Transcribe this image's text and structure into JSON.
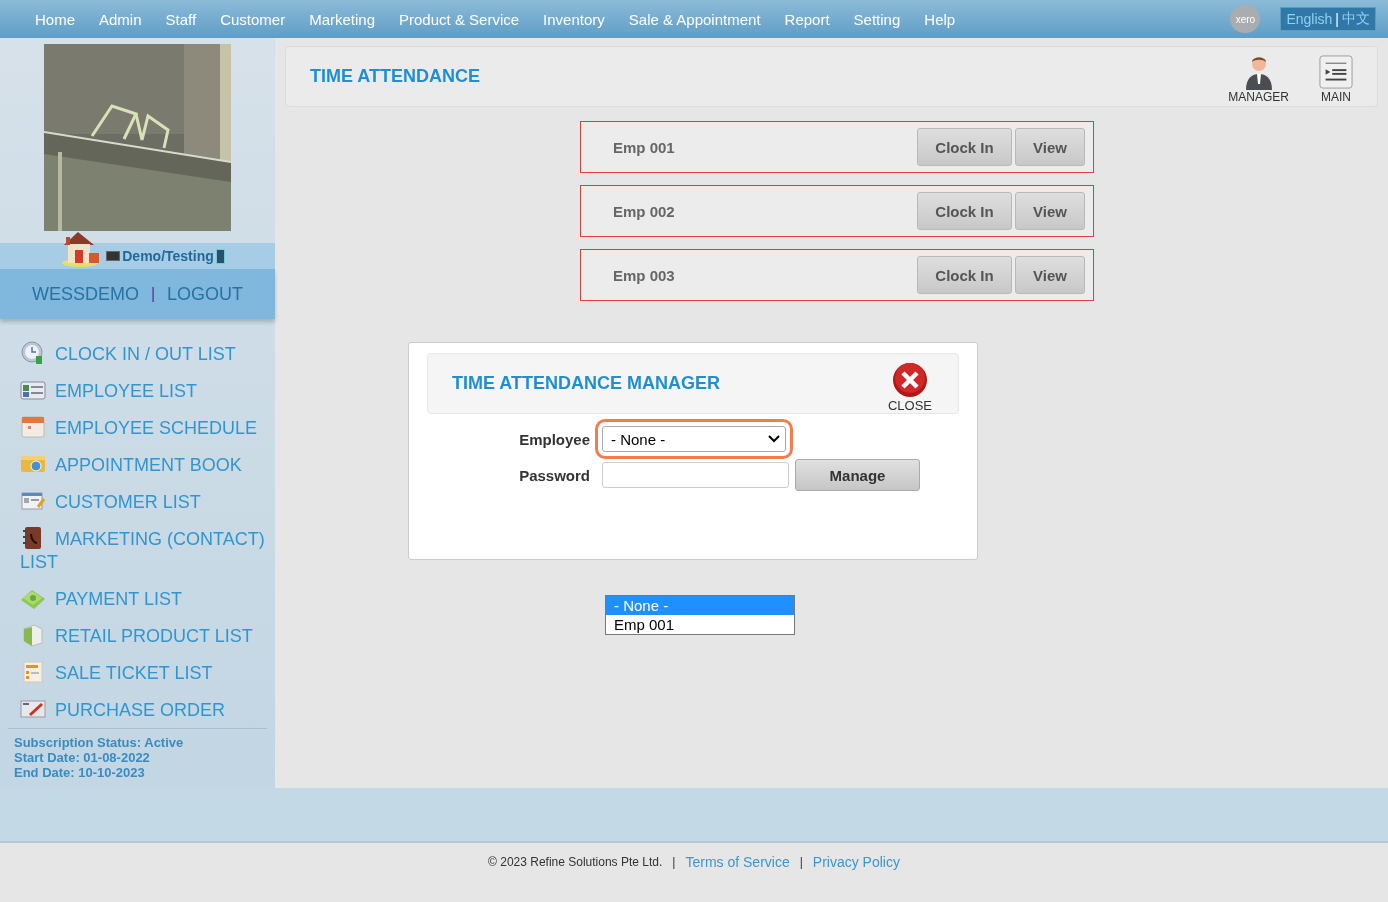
{
  "nav": {
    "items": [
      {
        "label": "Home"
      },
      {
        "label": "Admin"
      },
      {
        "label": "Staff"
      },
      {
        "label": "Customer"
      },
      {
        "label": "Marketing"
      },
      {
        "label": "Product & Service"
      },
      {
        "label": "Inventory"
      },
      {
        "label": "Sale & Appointment"
      },
      {
        "label": "Report"
      },
      {
        "label": "Setting"
      },
      {
        "label": "Help"
      }
    ],
    "xero_badge": "xero",
    "languages": [
      "English",
      "中文"
    ],
    "language_separator": "|"
  },
  "sidebar": {
    "mode_label": "Demo/Testing",
    "user": "WESSDEMO",
    "separator": "|",
    "logout": "LOGOUT",
    "menu": [
      {
        "kind": "clock",
        "label": "CLOCK IN / OUT LIST"
      },
      {
        "kind": "idcard",
        "label": "EMPLOYEE LIST"
      },
      {
        "kind": "calendar",
        "label": "EMPLOYEE SCHEDULE"
      },
      {
        "kind": "book",
        "label": "APPOINTMENT BOOK"
      },
      {
        "kind": "customer",
        "label": "CUSTOMER LIST"
      },
      {
        "kind": "contacts",
        "label": "MARKETING (CONTACT) LIST"
      },
      {
        "kind": "money",
        "label": "PAYMENT LIST"
      },
      {
        "kind": "product",
        "label": "RETAIL PRODUCT LIST"
      },
      {
        "kind": "ticket",
        "label": "SALE TICKET LIST"
      },
      {
        "kind": "order",
        "label": "PURCHASE ORDER"
      }
    ],
    "subscription": [
      "Subscription Status: Active",
      "Start Date: 01-08-2022",
      "End Date: 10-10-2023"
    ]
  },
  "header": {
    "title": "TIME ATTENDANCE",
    "actions": [
      {
        "kind": "manager",
        "label": "MANAGER"
      },
      {
        "kind": "main",
        "label": "MAIN"
      }
    ]
  },
  "employees": [
    {
      "name": "Emp 001",
      "buttons": [
        "Clock In",
        "View"
      ]
    },
    {
      "name": "Emp 002",
      "buttons": [
        "Clock In",
        "View"
      ]
    },
    {
      "name": "Emp 003",
      "buttons": [
        "Clock In",
        "View"
      ]
    }
  ],
  "manager_dialog": {
    "title": "TIME ATTENDANCE MANAGER",
    "close_label": "CLOSE",
    "employee_label": "Employee",
    "employee_value": "- None -",
    "employee_focused": true,
    "password_label": "Password",
    "manage_button": "Manage",
    "dropdown": [
      {
        "label": "- None -",
        "selected": true
      },
      {
        "label": "Emp 001",
        "selected": false
      }
    ]
  },
  "footer": {
    "copyright": "© 2023 Refine Solutions Pte Ltd.",
    "separator": "|",
    "links": [
      "Terms of Service",
      "Privacy Policy"
    ]
  }
}
